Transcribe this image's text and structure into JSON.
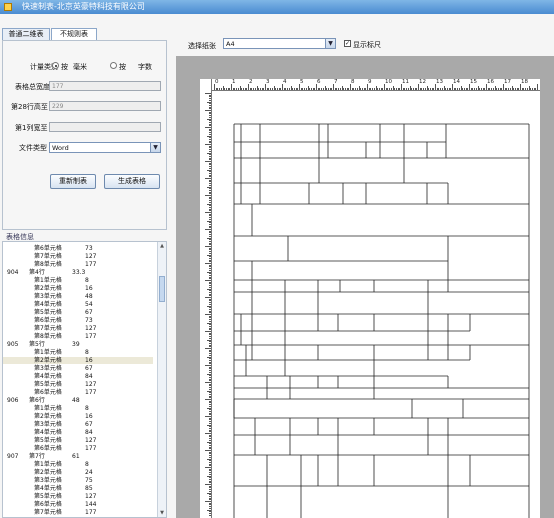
{
  "window": {
    "title": "快速制表-北京英豪特科技有限公司"
  },
  "tabs": [
    {
      "label": "普通二维表",
      "active": false
    },
    {
      "label": "不规则表",
      "active": true
    }
  ],
  "settings": {
    "measure_label": "计量类别",
    "option_mm_pre": "按",
    "option_mm": "毫米",
    "option_chars_pre": "按",
    "option_chars": "字数",
    "selected": "mm",
    "total_width_label": "表格总宽度",
    "total_width_value": "177",
    "row_height_label": "第28行高至",
    "row_height_value": "229",
    "col_width_label": "第1列宽至",
    "col_width_value": "",
    "file_type_label": "文件类型",
    "file_type_value": "Word"
  },
  "buttons": {
    "redraw": "重新制表",
    "generate": "生成表格"
  },
  "info": {
    "title": "表格信息",
    "rows": [
      {
        "c0": "",
        "c1": "第6单元格",
        "c2": "73",
        "sub": true
      },
      {
        "c0": "",
        "c1": "第7单元格",
        "c2": "127",
        "sub": true
      },
      {
        "c0": "",
        "c1": "第8单元格",
        "c2": "177",
        "sub": true
      },
      {
        "c0": "904",
        "c1": "第4行",
        "c2": "33.3",
        "sub": false
      },
      {
        "c0": "",
        "c1": "第1单元格",
        "c2": "8",
        "sub": true
      },
      {
        "c0": "",
        "c1": "第2单元格",
        "c2": "16",
        "sub": true
      },
      {
        "c0": "",
        "c1": "第3单元格",
        "c2": "48",
        "sub": true
      },
      {
        "c0": "",
        "c1": "第4单元格",
        "c2": "54",
        "sub": true
      },
      {
        "c0": "",
        "c1": "第5单元格",
        "c2": "67",
        "sub": true
      },
      {
        "c0": "",
        "c1": "第6单元格",
        "c2": "73",
        "sub": true
      },
      {
        "c0": "",
        "c1": "第7单元格",
        "c2": "127",
        "sub": true
      },
      {
        "c0": "",
        "c1": "第8单元格",
        "c2": "177",
        "sub": true
      },
      {
        "c0": "905",
        "c1": "第5行",
        "c2": "39",
        "sub": false
      },
      {
        "c0": "",
        "c1": "第1单元格",
        "c2": "8",
        "sub": true
      },
      {
        "c0": "",
        "c1": "第2单元格",
        "c2": "16",
        "sub": true,
        "selected": true
      },
      {
        "c0": "",
        "c1": "第3单元格",
        "c2": "67",
        "sub": true
      },
      {
        "c0": "",
        "c1": "第4单元格",
        "c2": "84",
        "sub": true
      },
      {
        "c0": "",
        "c1": "第5单元格",
        "c2": "127",
        "sub": true
      },
      {
        "c0": "",
        "c1": "第6单元格",
        "c2": "177",
        "sub": true
      },
      {
        "c0": "906",
        "c1": "第6行",
        "c2": "48",
        "sub": false
      },
      {
        "c0": "",
        "c1": "第1单元格",
        "c2": "8",
        "sub": true
      },
      {
        "c0": "",
        "c1": "第2单元格",
        "c2": "16",
        "sub": true
      },
      {
        "c0": "",
        "c1": "第3单元格",
        "c2": "67",
        "sub": true
      },
      {
        "c0": "",
        "c1": "第4单元格",
        "c2": "84",
        "sub": true
      },
      {
        "c0": "",
        "c1": "第5单元格",
        "c2": "127",
        "sub": true
      },
      {
        "c0": "",
        "c1": "第6单元格",
        "c2": "177",
        "sub": true
      },
      {
        "c0": "907",
        "c1": "第7行",
        "c2": "61",
        "sub": false
      },
      {
        "c0": "",
        "c1": "第1单元格",
        "c2": "8",
        "sub": true
      },
      {
        "c0": "",
        "c1": "第2单元格",
        "c2": "24",
        "sub": true
      },
      {
        "c0": "",
        "c1": "第3单元格",
        "c2": "75",
        "sub": true
      },
      {
        "c0": "",
        "c1": "第4单元格",
        "c2": "85",
        "sub": true
      },
      {
        "c0": "",
        "c1": "第5单元格",
        "c2": "127",
        "sub": true
      },
      {
        "c0": "",
        "c1": "第6单元格",
        "c2": "144",
        "sub": true
      },
      {
        "c0": "",
        "c1": "第7单元格",
        "c2": "177",
        "sub": true
      }
    ]
  },
  "paper": {
    "label": "选择纸张",
    "value": "A4",
    "show_ruler_label": "显示标尺",
    "show_ruler_checked": true
  },
  "ruler_numbers": [
    "0",
    "1",
    "2",
    "3",
    "4",
    "5",
    "6",
    "7",
    "8",
    "9",
    "10",
    "11",
    "12",
    "13",
    "14",
    "15",
    "16",
    "17",
    "18",
    "19",
    "20"
  ]
}
